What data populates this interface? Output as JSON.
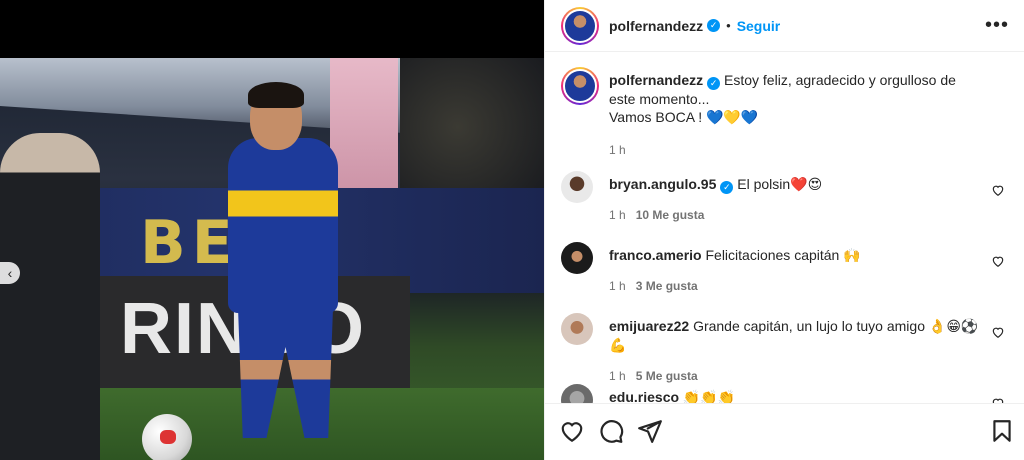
{
  "post": {
    "username": "polfernandezz",
    "follow_label": "Seguir",
    "caption_line1": "Estoy feliz, agradecido y orgulloso de este momento...",
    "caption_line2": "Vamos BOCA !",
    "caption_emojis": "💙💛💙",
    "time": "1 h"
  },
  "comments": [
    {
      "username": "bryan.angulo.95",
      "text": "El polsin",
      "emojis": "❤️😍",
      "time": "1 h",
      "likes": "10 Me gusta"
    },
    {
      "username": "franco.amerio",
      "text": "Felicitaciones capitán",
      "emojis": "🙌",
      "time": "1 h",
      "likes": "3 Me gusta"
    },
    {
      "username": "emijuarez22",
      "text": "Grande capitán, un lujo lo tuyo amigo",
      "emojis": "👌😁⚽💪",
      "time": "1 h",
      "likes": "5 Me gusta"
    },
    {
      "username": "edu.riesco",
      "text": "",
      "emojis": "👏👏👏"
    }
  ],
  "photo": {
    "banner_text": "BER",
    "board_text": "RINGO"
  },
  "icons": {
    "verified": "verified-badge-icon",
    "more": "more-options-icon",
    "like": "heart-icon",
    "comment": "comment-icon",
    "share": "share-icon",
    "save": "bookmark-icon",
    "prev": "chevron-left-icon"
  },
  "colors": {
    "accent": "#0095f6",
    "text": "#262626",
    "muted": "#737373"
  }
}
